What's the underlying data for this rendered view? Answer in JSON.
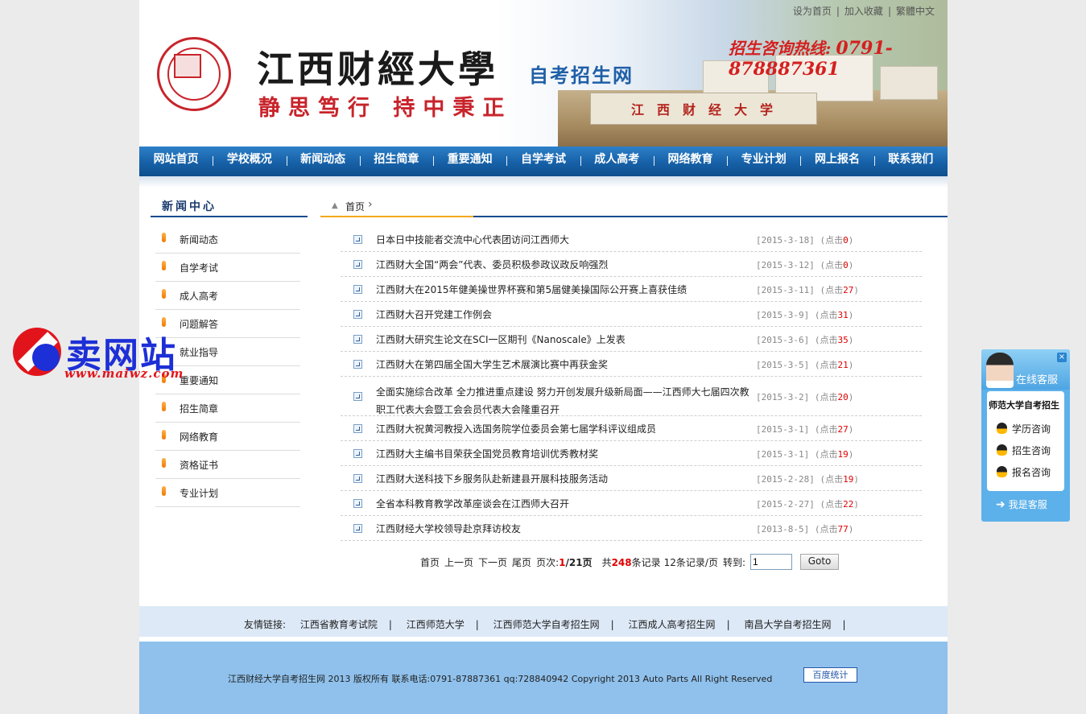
{
  "header": {
    "toplinks": [
      "设为首页",
      "加入收藏",
      "繁體中文"
    ],
    "university": "江西财經大學",
    "site": "自考招生网",
    "motto": "静思笃行 持中秉正",
    "hotline_label": "招生咨询热线:",
    "hotline_number": "0791-878887361",
    "sign_text": "江西财经大学"
  },
  "nav": [
    "网站首页",
    "学校概况",
    "新闻动态",
    "招生简章",
    "重要通知",
    "自学考试",
    "成人高考",
    "网络教育",
    "专业计划",
    "网上报名",
    "联系我们"
  ],
  "sidebar": {
    "title": "新闻中心",
    "items": [
      "新闻动态",
      "自学考试",
      "成人高考",
      "问题解答",
      "就业指导",
      "重要通知",
      "招生简章",
      "网络教育",
      "资格证书",
      "专业计划"
    ]
  },
  "breadcrumb": {
    "home": "首页"
  },
  "news": [
    {
      "title": "日本日中技能者交流中心代表团访问江西师大",
      "date": "[2015-3-18]",
      "click_label": "(点击",
      "count": "0",
      "close": ")"
    },
    {
      "title": "江西财大全国“两会”代表、委员积极参政议政反响强烈",
      "date": "[2015-3-12]",
      "click_label": "(点击",
      "count": "0",
      "close": ")"
    },
    {
      "title": "江西财大在2015年健美操世界杯赛和第5届健美操国际公开赛上喜获佳绩",
      "date": "[2015-3-11]",
      "click_label": "(点击",
      "count": "27",
      "close": ")"
    },
    {
      "title": "江西财大召开党建工作例会",
      "date": "[2015-3-9]",
      "click_label": "(点击",
      "count": "31",
      "close": ")"
    },
    {
      "title": "江西财大研究生论文在SCI一区期刊《Nanoscale》上发表",
      "date": "[2015-3-6]",
      "click_label": "(点击",
      "count": "35",
      "close": ")"
    },
    {
      "title": "江西财大在第四届全国大学生艺术展演比赛中再获金奖",
      "date": "[2015-3-5]",
      "click_label": "(点击",
      "count": "21",
      "close": ")"
    },
    {
      "title": "全面实施综合改革 全力推进重点建设 努力开创发展升级新局面——江西师大七届四次教职工代表大会暨工会会员代表大会隆重召开",
      "date": "[2015-3-2]",
      "click_label": "(点击",
      "count": "20",
      "close": ")",
      "tall": true
    },
    {
      "title": "江西财大祝黄河教授入选国务院学位委员会第七届学科评议组成员",
      "date": "[2015-3-1]",
      "click_label": "(点击",
      "count": "27",
      "close": ")"
    },
    {
      "title": "江西财大主编书目荣获全国党员教育培训优秀教材奖",
      "date": "[2015-3-1]",
      "click_label": "(点击",
      "count": "19",
      "close": ")"
    },
    {
      "title": "江西财大送科技下乡服务队赴新建县开展科技服务活动",
      "date": "[2015-2-28]",
      "click_label": "(点击",
      "count": "19",
      "close": ")"
    },
    {
      "title": "全省本科教育教学改革座谈会在江西师大召开",
      "date": "[2015-2-27]",
      "click_label": "(点击",
      "count": "22",
      "close": ")"
    },
    {
      "title": "江西财经大学校领导赴京拜访校友",
      "date": "[2013-8-5]",
      "click_label": "(点击",
      "count": "77",
      "close": ")"
    }
  ],
  "pager": {
    "first": "首页",
    "prev": "上一页",
    "next": "下一页",
    "last": "尾页",
    "page_label": "页次:",
    "page_current": "1",
    "page_total": "/21页",
    "total_prefix": "共",
    "total": "248",
    "total_suffix": "条记录",
    "per_page": "12条记录/页",
    "goto_label": "转到:",
    "goto_value": "1",
    "goto_button": "Goto"
  },
  "friend_links": {
    "label": "友情链接:",
    "items": [
      "江西省教育考试院",
      "江西师范大学",
      "江西师范大学自考招生网",
      "江西成人高考招生网",
      "南昌大学自考招生网"
    ]
  },
  "footer": {
    "text": "江西财经大学自考招生网 2013 版权所有 联系电话:0791-87887361 qq:728840942 Copyright 2013 Auto Parts All Right Reserved",
    "badge": "百度统计"
  },
  "watermark": {
    "big": "卖网站",
    "url": "www.maiwz.com"
  },
  "service": {
    "header": "在线客服",
    "title": "师范大学自考招生",
    "items": [
      "学历咨询",
      "招生咨询",
      "报名咨询"
    ],
    "me": "我是客服",
    "close": "×"
  }
}
